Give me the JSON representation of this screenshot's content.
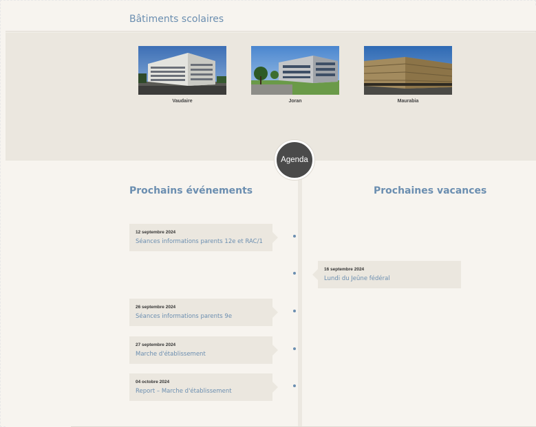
{
  "buildings": {
    "title": "Bâtiments scolaires",
    "items": [
      {
        "name": "Vaudaire"
      },
      {
        "name": "Joran"
      },
      {
        "name": "Maurabia"
      }
    ]
  },
  "agenda": {
    "badge": "Agenda",
    "left_title": "Prochains événements",
    "right_title": "Prochaines vacances",
    "events": [
      {
        "date": "12 septembre 2024",
        "title": "Séances informations parents 12e et RAC/1"
      },
      {
        "date": "26 septembre 2024",
        "title": "Séances informations parents 9e"
      },
      {
        "date": "27 septembre 2024",
        "title": "Marche d'établissement"
      },
      {
        "date": "04 octobre 2024",
        "title": "Report – Marche d'établissement"
      }
    ],
    "vacations": [
      {
        "date": "16 septembre 2024",
        "title": "Lundi du Jeûne fédéral"
      }
    ]
  }
}
